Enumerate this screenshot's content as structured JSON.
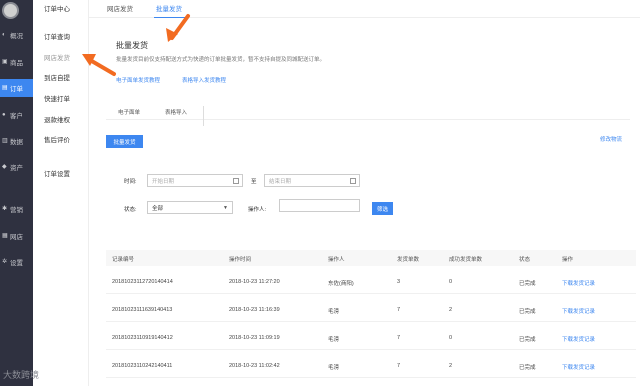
{
  "leftnav": {
    "items": [
      {
        "label": "概况",
        "icon": "dashboard-icon"
      },
      {
        "label": "商品",
        "icon": "product-icon"
      },
      {
        "label": "订单",
        "icon": "order-icon"
      },
      {
        "label": "客户",
        "icon": "customer-icon"
      },
      {
        "label": "数据",
        "icon": "data-icon"
      },
      {
        "label": "资产",
        "icon": "asset-icon"
      },
      {
        "label": "营销",
        "icon": "marketing-icon"
      },
      {
        "label": "网店",
        "icon": "store-icon"
      },
      {
        "label": "设置",
        "icon": "settings-icon"
      }
    ]
  },
  "subnav": {
    "title": "订单中心",
    "items": [
      "订单查询",
      "网店发货",
      "到店自提",
      "快速打单",
      "退款维权",
      "售后评价"
    ],
    "settings": "订单设置"
  },
  "tabs": [
    "网店发货",
    "批量发货"
  ],
  "main": {
    "title": "批量发货",
    "description": "批量发货目前仅支持配送方式为快递的订单批量发货，暂不支持自提及同城配送订单。",
    "link1": "电子面单发货教程",
    "link2": "表格导入发货教程",
    "subtabs": [
      "电子面单",
      "表格导入"
    ],
    "batch_button": "批量发货",
    "edit_link": "修改物流"
  },
  "filter": {
    "time_label": "时间:",
    "start_placeholder": "开始日期",
    "to": "至",
    "end_placeholder": "结束日期",
    "status_label": "状态:",
    "status_value": "全部",
    "operator_label": "操作人:",
    "search_button": "筛选"
  },
  "table": {
    "headers": [
      "记录编号",
      "操作时间",
      "操作人",
      "发货单数",
      "成功发货单数",
      "状态",
      "操作"
    ],
    "rows": [
      [
        "2018102311272014041​4",
        "2018-10-23 11:27:20",
        "东佐(商阳)",
        "3",
        "0",
        "已完成",
        "下载发货记录"
      ],
      [
        "20181023111639140413",
        "2018-10-23 11:16:39",
        "毛滂",
        "7",
        "2",
        "已完成",
        "下载发货记录"
      ],
      [
        "20181023110919140412",
        "2018-10-23 11:09:19",
        "毛滂",
        "7",
        "0",
        "已完成",
        "下载发货记录"
      ],
      [
        "20181023110242140411",
        "2018-10-23 11:02:42",
        "毛滂",
        "7",
        "2",
        "已完成",
        "下载发货记录"
      ]
    ]
  },
  "watermark": "大数跨境",
  "colors": {
    "accent": "#3d87f0",
    "nav_bg": "#2f3140",
    "arrow": "#f26b21"
  }
}
